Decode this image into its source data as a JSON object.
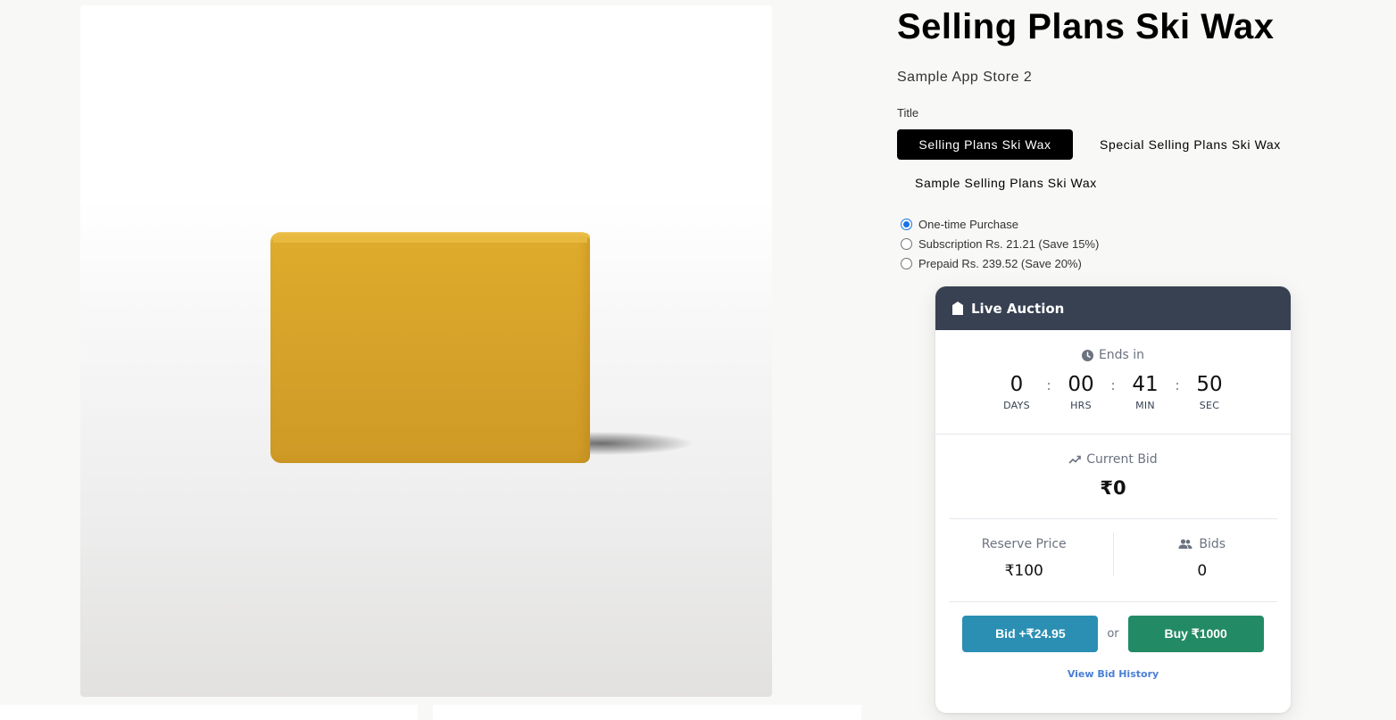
{
  "product": {
    "title": "Selling Plans Ski Wax",
    "vendor": "Sample App Store 2",
    "variant_label": "Title",
    "variants": [
      {
        "label": "Selling Plans Ski Wax",
        "selected": true
      },
      {
        "label": "Special Selling Plans Ski Wax",
        "selected": false
      },
      {
        "label": "Sample Selling Plans Ski Wax",
        "selected": false
      }
    ],
    "purchase_options": [
      {
        "label": "One-time Purchase",
        "selected": true
      },
      {
        "label": "Subscription Rs. 21.21 (Save 15%)",
        "selected": false
      },
      {
        "label": "Prepaid Rs. 239.52 (Save 20%)",
        "selected": false
      }
    ]
  },
  "auction": {
    "header": "Live Auction",
    "ends_label": "Ends in",
    "countdown": {
      "days": "0",
      "days_label": "DAYS",
      "hours": "00",
      "hours_label": "HRS",
      "minutes": "41",
      "minutes_label": "MIN",
      "seconds": "50",
      "seconds_label": "SEC",
      "separator": ":"
    },
    "current_bid_label": "Current Bid",
    "current_bid": "₹0",
    "reserve_label": "Reserve Price",
    "reserve_value": "₹100",
    "bids_label": "Bids",
    "bids_value": "0",
    "bid_button": "Bid +₹24.95",
    "or_label": "or",
    "buy_button": "Buy ₹1000",
    "history_link": "View Bid History"
  },
  "colors": {
    "header_bg": "#374151",
    "bid_button": "#2a8fb3",
    "buy_button": "#238a66",
    "link": "#4a7fd6",
    "radio_accent": "#1a73e8"
  },
  "icons": [
    "auction-tag-icon",
    "clock-icon",
    "trending-up-icon",
    "users-icon"
  ]
}
